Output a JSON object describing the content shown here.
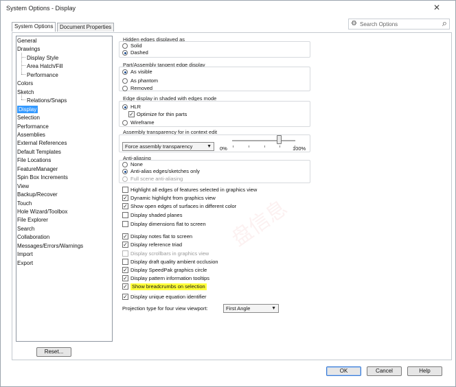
{
  "window": {
    "title": "System Options - Display"
  },
  "tabs": [
    {
      "label": "System Options",
      "active": true
    },
    {
      "label": "Document Properties",
      "active": false
    }
  ],
  "search": {
    "placeholder": "Search Options"
  },
  "tree": {
    "items": [
      {
        "label": "General",
        "level": 0
      },
      {
        "label": "Drawings",
        "level": 0
      },
      {
        "label": "Display Style",
        "level": 1
      },
      {
        "label": "Area Hatch/Fill",
        "level": 1
      },
      {
        "label": "Performance",
        "level": 1
      },
      {
        "label": "Colors",
        "level": 0
      },
      {
        "label": "Sketch",
        "level": 0
      },
      {
        "label": "Relations/Snaps",
        "level": 1
      },
      {
        "label": "Display",
        "level": 0,
        "selected": true
      },
      {
        "label": "Selection",
        "level": 0
      },
      {
        "label": "Performance",
        "level": 0
      },
      {
        "label": "Assemblies",
        "level": 0
      },
      {
        "label": "External References",
        "level": 0
      },
      {
        "label": "Default Templates",
        "level": 0
      },
      {
        "label": "File Locations",
        "level": 0
      },
      {
        "label": "FeatureManager",
        "level": 0
      },
      {
        "label": "Spin Box Increments",
        "level": 0
      },
      {
        "label": "View",
        "level": 0
      },
      {
        "label": "Backup/Recover",
        "level": 0
      },
      {
        "label": "Touch",
        "level": 0
      },
      {
        "label": "Hole Wizard/Toolbox",
        "level": 0
      },
      {
        "label": "File Explorer",
        "level": 0
      },
      {
        "label": "Search",
        "level": 0
      },
      {
        "label": "Collaboration",
        "level": 0
      },
      {
        "label": "Messages/Errors/Warnings",
        "level": 0
      },
      {
        "label": "Import",
        "level": 0
      },
      {
        "label": "Export",
        "level": 0
      }
    ]
  },
  "reset_label": "Reset...",
  "hidden_edges": {
    "title": "Hidden edges displayed as",
    "options": [
      {
        "label": "Solid",
        "selected": false
      },
      {
        "label": "Dashed",
        "selected": true
      }
    ]
  },
  "tangent_edges": {
    "title": "Part/Assembly tangent edge display",
    "options": [
      {
        "label": "As visible",
        "selected": true
      },
      {
        "label": "As phantom",
        "selected": false
      },
      {
        "label": "Removed",
        "selected": false
      }
    ]
  },
  "shaded_edges": {
    "title": "Edge display in shaded with edges mode",
    "hlr": {
      "label": "HLR",
      "selected": true
    },
    "thin_parts": {
      "label": "Optimize for thin parts",
      "checked": true
    },
    "wireframe": {
      "label": "Wireframe",
      "selected": false
    }
  },
  "transparency": {
    "title": "Assembly transparency for in context edit",
    "select_value": "Force assembly transparency",
    "min_label": "0%",
    "max_label": "100%",
    "value_fraction": 0.78
  },
  "antialiasing": {
    "title": "Anti-aliasing",
    "options": [
      {
        "label": "None",
        "selected": false,
        "disabled": false
      },
      {
        "label": "Anti-alias edges/sketches only",
        "selected": true,
        "disabled": false
      },
      {
        "label": "Full scene anti-aliasing",
        "selected": false,
        "disabled": true
      }
    ]
  },
  "checks_a": [
    {
      "label": "Highlight all edges of features selected in graphics view",
      "checked": false
    },
    {
      "label": "Dynamic highlight from graphics view",
      "checked": true
    },
    {
      "label": "Show open edges of surfaces in different color",
      "checked": true
    },
    {
      "label": "Display shaded planes",
      "checked": false
    },
    {
      "label": "Display dimensions flat to screen",
      "checked": false
    }
  ],
  "checks_b": [
    {
      "label": "Display notes flat to screen",
      "checked": true
    },
    {
      "label": "Display reference triad",
      "checked": true
    },
    {
      "label": "Display scrollbars in graphics view",
      "checked": false,
      "disabled": true
    },
    {
      "label": "Display draft quality ambient occlusion",
      "checked": false
    },
    {
      "label": "Display SpeedPak graphics circle",
      "checked": true
    },
    {
      "label": "Display pattern information tooltips",
      "checked": true
    },
    {
      "label": "Show breadcrumbs on selection",
      "checked": true,
      "highlighted": true
    },
    {
      "label": "Display unique equation identifier",
      "checked": true
    }
  ],
  "projection": {
    "label": "Projection type for four view viewport:",
    "value": "First Angle"
  },
  "buttons": {
    "ok": "OK",
    "cancel": "Cancel",
    "help": "Help"
  },
  "colors": {
    "selection": "#3399ff",
    "highlight": "#ffff3a"
  }
}
